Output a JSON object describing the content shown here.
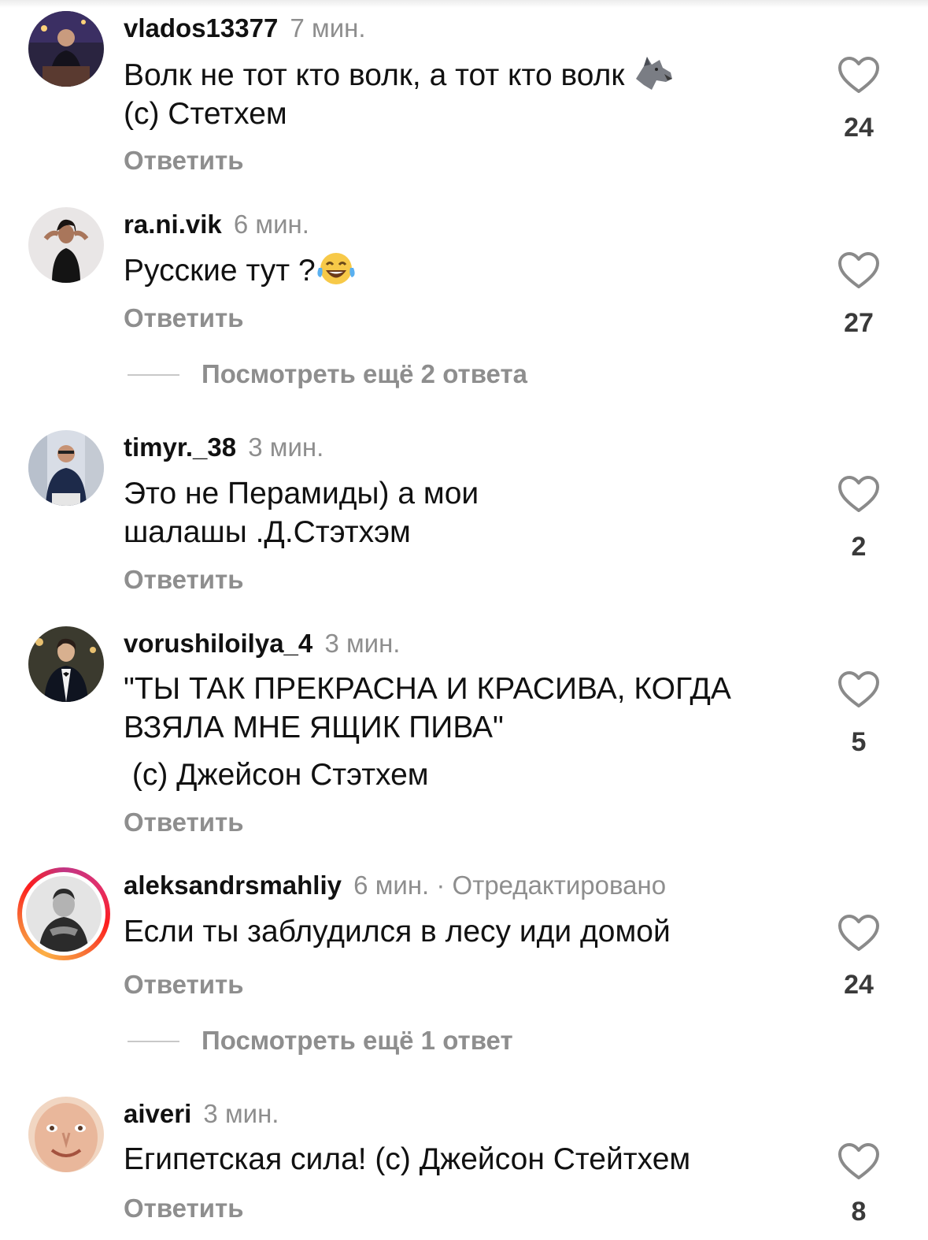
{
  "comments": [
    {
      "username": "vlados13377",
      "time": "7 мин.",
      "lines": [
        "Волк не  тот кто волк,  а тот кто волк",
        "(с) Стетхем"
      ],
      "emoji": "wolf-emoji",
      "likes": "24",
      "reply_label": "Ответить"
    },
    {
      "username": "ra.ni.vik",
      "time": "6 мин.",
      "lines": [
        "Русские тут ?"
      ],
      "emoji": "laughing-tears-emoji",
      "likes": "27",
      "reply_label": "Ответить",
      "more_replies": "Посмотреть ещё 2 ответа"
    },
    {
      "username": "timyr._38",
      "time": "3 мин.",
      "lines": [
        "Это не Перамиды) а мои",
        "шалашы .Д.Стэтхэм"
      ],
      "likes": "2",
      "reply_label": "Ответить"
    },
    {
      "username": "vorushiloilya_4",
      "time": "3 мин.",
      "lines": [
        "\"ТЫ ТАК ПРЕКРАСНА И КРАСИВА, КОГДА",
        "ВЗЯЛА МНЕ ЯЩИК ПИВА\"",
        " (с) Джейсон Стэтхем"
      ],
      "likes": "5",
      "reply_label": "Ответить"
    },
    {
      "username": "aleksandrsmahliy",
      "time": "6 мин.",
      "edited": "· Отредактировано",
      "lines": [
        "Если ты заблудился в лесу иди домой"
      ],
      "likes": "24",
      "reply_label": "Ответить",
      "more_replies": "Посмотреть ещё 1 ответ"
    },
    {
      "username": "aiveri",
      "time": "3 мин.",
      "lines": [
        "Египетская сила! (с) Джейсон Стейтхем"
      ],
      "likes": "8",
      "reply_label": "Ответить"
    }
  ],
  "icons": {
    "like": "heart-outline-icon"
  },
  "colors": {
    "muted": "#8e8e8e",
    "story_ring": "#e1306c"
  }
}
